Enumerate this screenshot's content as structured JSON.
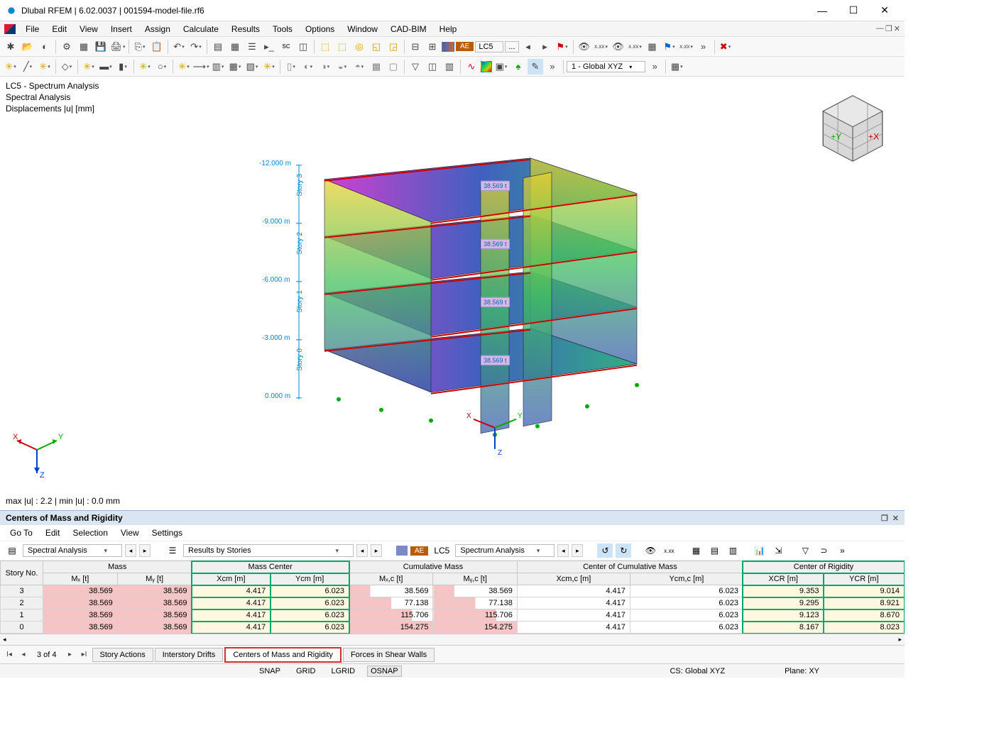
{
  "window": {
    "title": "Dlubal RFEM | 6.02.0037 | 001594-model-file.rf6"
  },
  "menu": [
    "File",
    "Edit",
    "View",
    "Insert",
    "Assign",
    "Calculate",
    "Results",
    "Tools",
    "Options",
    "Window",
    "CAD-BIM",
    "Help"
  ],
  "toolbar1": {
    "ae": "AE",
    "lc": "LC5",
    "ellipsis": "...",
    "global": "1 - Global XYZ"
  },
  "viewport": {
    "line1": "LC5 - Spectrum Analysis",
    "line2": "Spectral Analysis",
    "line3": "Displacements |u| [mm]",
    "stats": "max |u| : 2.2 | min |u| : 0.0 mm",
    "stories": [
      "Story 0",
      "Story 1",
      "Story 2",
      "Story 3"
    ],
    "dims": [
      "0.000 m",
      "-3.000 m",
      "-6.000 m",
      "-9.000 m",
      "-12.000 m"
    ],
    "mass_tag": "38.569 t",
    "axes": {
      "x": "X",
      "y": "Y",
      "z": "Z",
      "px": "+X",
      "py": "+Y"
    }
  },
  "panel": {
    "title": "Centers of Mass and Rigidity",
    "menu": [
      "Go To",
      "Edit",
      "Selection",
      "View",
      "Settings"
    ],
    "sel_analysis": "Spectral Analysis",
    "sel_results": "Results by Stories",
    "sel_lc_badge": "AE",
    "sel_lc": "LC5",
    "sel_lc_name": "Spectrum Analysis",
    "tabs": [
      "Story Actions",
      "Interstory Drifts",
      "Centers of Mass and Rigidity",
      "Forces in Shear Walls"
    ],
    "page": "3 of 4"
  },
  "table": {
    "groups": [
      "Story No.",
      "Mass",
      "Mass Center",
      "Cumulative Mass",
      "Center of Cumulative Mass",
      "Center of Rigidity"
    ],
    "cols": [
      "",
      "Mₓ [t]",
      "Mᵧ [t]",
      "Xcm [m]",
      "Ycm [m]",
      "Mₓ,c [t]",
      "Mᵧ,c [t]",
      "Xcm,c [m]",
      "Ycm,c [m]",
      "XCR [m]",
      "YCR [m]"
    ],
    "rows": [
      {
        "no": "3",
        "mx": "38.569",
        "my": "38.569",
        "xcm": "4.417",
        "ycm": "6.023",
        "mxc": "38.569",
        "myc": "38.569",
        "xcc": "4.417",
        "ycc": "6.023",
        "xcr": "9.353",
        "ycr": "9.014",
        "p": 25
      },
      {
        "no": "2",
        "mx": "38.569",
        "my": "38.569",
        "xcm": "4.417",
        "ycm": "6.023",
        "mxc": "77.138",
        "myc": "77.138",
        "xcc": "4.417",
        "ycc": "6.023",
        "xcr": "9.295",
        "ycr": "8.921",
        "p": 50
      },
      {
        "no": "1",
        "mx": "38.569",
        "my": "38.569",
        "xcm": "4.417",
        "ycm": "6.023",
        "mxc": "115.706",
        "myc": "115.706",
        "xcc": "4.417",
        "ycc": "6.023",
        "xcr": "9.123",
        "ycr": "8.670",
        "p": 75
      },
      {
        "no": "0",
        "mx": "38.569",
        "my": "38.569",
        "xcm": "4.417",
        "ycm": "6.023",
        "mxc": "154.275",
        "myc": "154.275",
        "xcc": "4.417",
        "ycc": "6.023",
        "xcr": "8.167",
        "ycr": "8.023",
        "p": 100
      }
    ]
  },
  "status": {
    "snap": "SNAP",
    "grid": "GRID",
    "lgrid": "LGRID",
    "osnap": "OSNAP",
    "cs": "CS: Global XYZ",
    "plane": "Plane: XY"
  }
}
